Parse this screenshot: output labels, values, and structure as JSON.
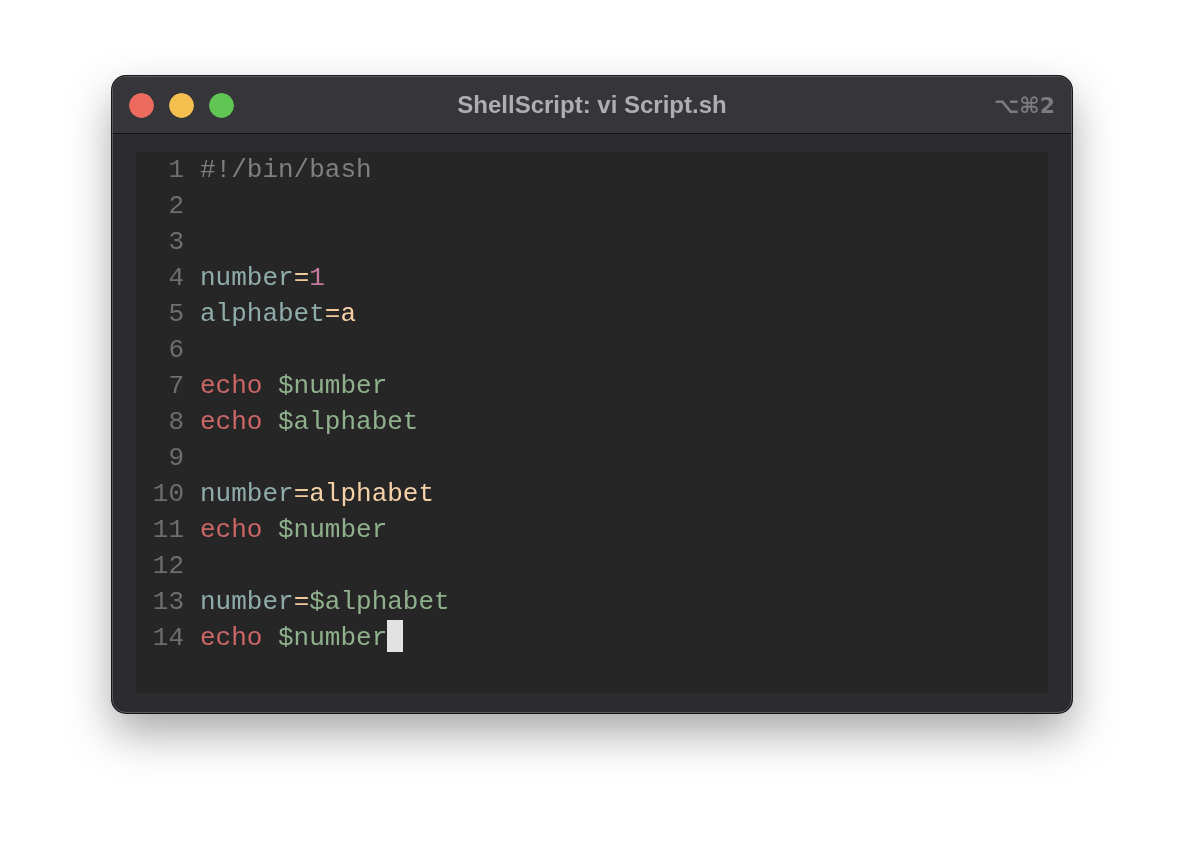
{
  "window": {
    "title": "ShellScript: vi Script.sh",
    "shortcut": "⌥⌘2"
  },
  "editor": {
    "lines": [
      {
        "number": "1",
        "cursor": false,
        "tokens": [
          {
            "kind": "comment",
            "text": "#!/bin/bash"
          }
        ]
      },
      {
        "number": "2",
        "cursor": false
      },
      {
        "number": "3",
        "cursor": false
      },
      {
        "number": "4",
        "cursor": false,
        "tokens": [
          {
            "kind": "name",
            "text": "number"
          },
          {
            "kind": "operator",
            "text": "="
          },
          {
            "kind": "number",
            "text": "1"
          }
        ]
      },
      {
        "number": "5",
        "cursor": false,
        "tokens": [
          {
            "kind": "name",
            "text": "alphabet"
          },
          {
            "kind": "operator",
            "text": "="
          },
          {
            "kind": "string",
            "text": "a"
          }
        ]
      },
      {
        "number": "6",
        "cursor": false
      },
      {
        "number": "7",
        "cursor": false,
        "tokens": [
          {
            "kind": "keyword",
            "text": "echo "
          },
          {
            "kind": "variable",
            "text": "$number"
          }
        ]
      },
      {
        "number": "8",
        "cursor": false,
        "tokens": [
          {
            "kind": "keyword",
            "text": "echo "
          },
          {
            "kind": "variable",
            "text": "$alphabet"
          }
        ]
      },
      {
        "number": "9",
        "cursor": false
      },
      {
        "number": "10",
        "cursor": false,
        "tokens": [
          {
            "kind": "name",
            "text": "number"
          },
          {
            "kind": "operator",
            "text": "="
          },
          {
            "kind": "string",
            "text": "alphabet"
          }
        ]
      },
      {
        "number": "11",
        "cursor": false,
        "tokens": [
          {
            "kind": "keyword",
            "text": "echo "
          },
          {
            "kind": "variable",
            "text": "$number"
          }
        ]
      },
      {
        "number": "12",
        "cursor": false
      },
      {
        "number": "13",
        "cursor": false,
        "tokens": [
          {
            "kind": "name",
            "text": "number"
          },
          {
            "kind": "operator",
            "text": "="
          },
          {
            "kind": "variable",
            "text": "$alphabet"
          }
        ]
      },
      {
        "number": "14",
        "cursor": true,
        "tokens": [
          {
            "kind": "keyword",
            "text": "echo "
          },
          {
            "kind": "variable",
            "text": "$number"
          }
        ]
      }
    ]
  }
}
